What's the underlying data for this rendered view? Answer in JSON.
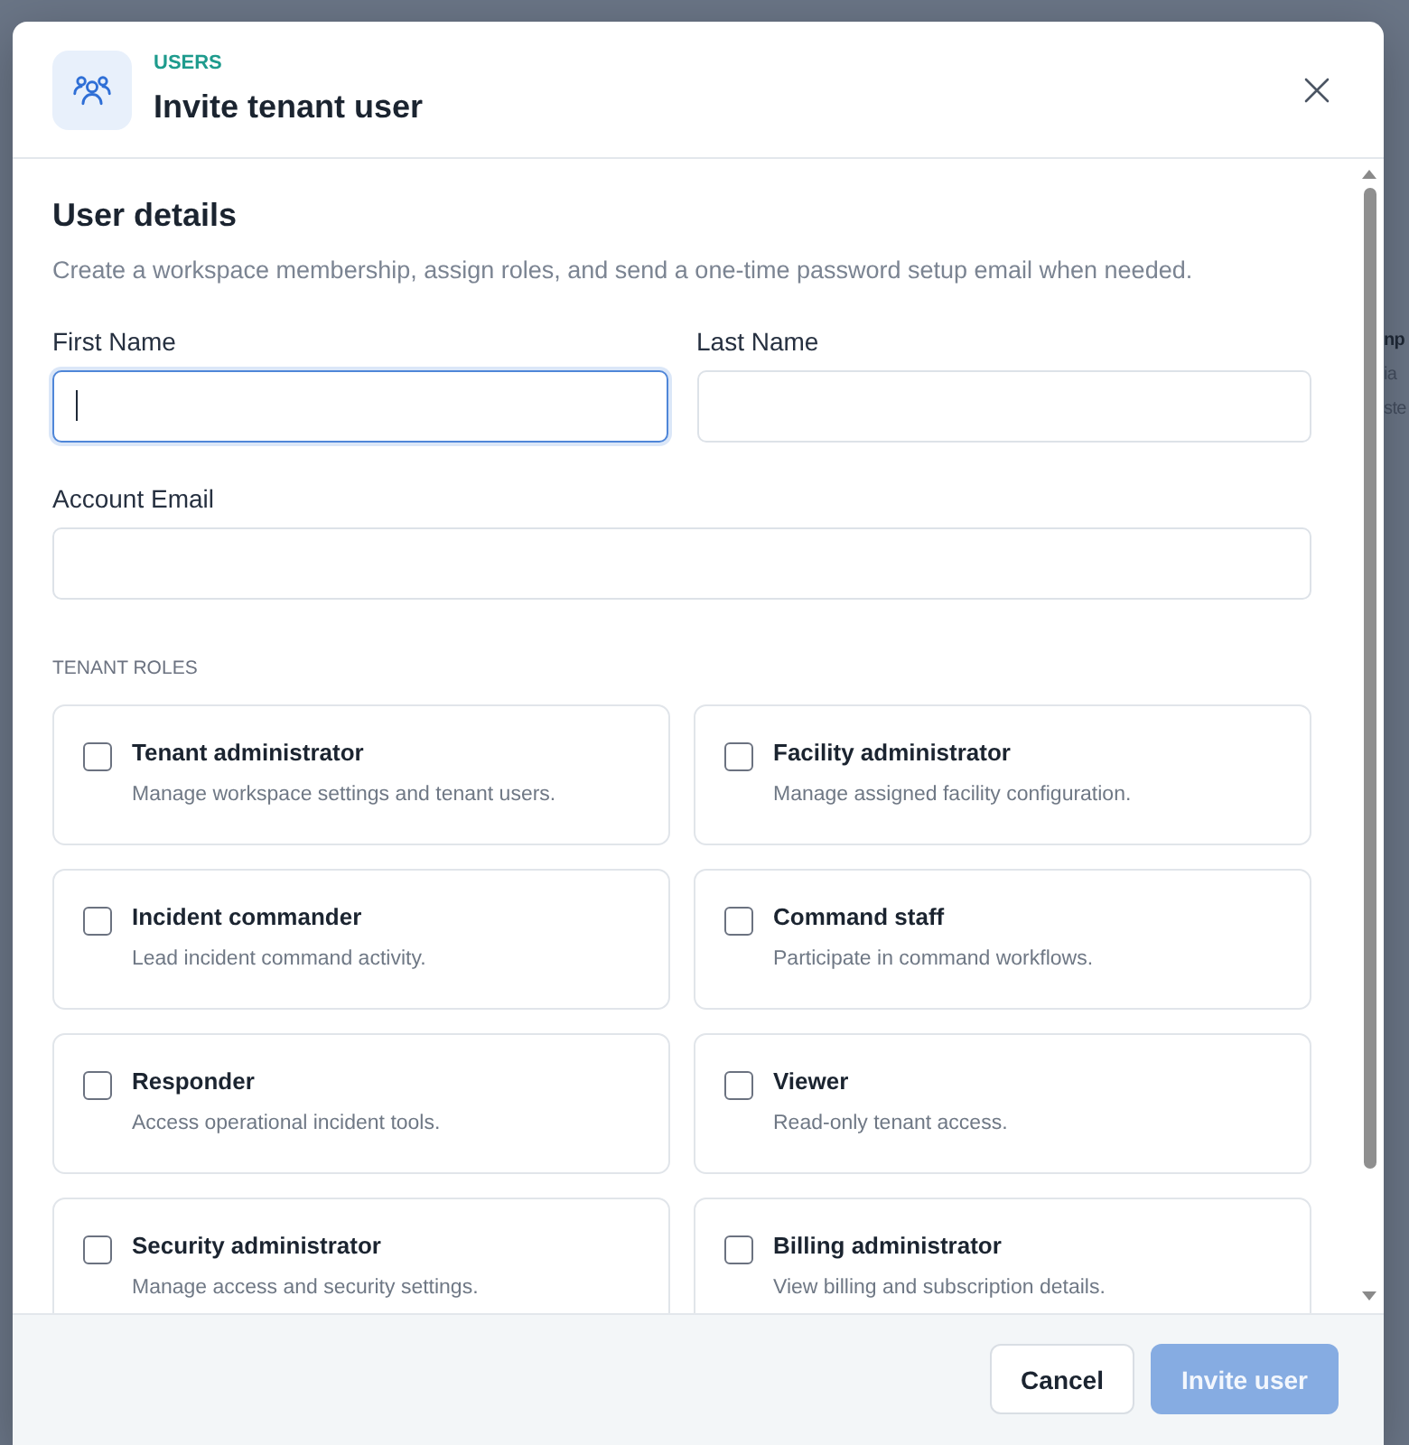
{
  "backdrop": {
    "fragments": [
      {
        "text": "np",
        "kind": "title"
      },
      {
        "text": "ia",
        "kind": "meta"
      },
      {
        "text": "ste",
        "kind": "meta"
      }
    ]
  },
  "dialog": {
    "eyebrow": "USERS",
    "title": "Invite tenant user"
  },
  "section": {
    "title": "User details",
    "description": "Create a workspace membership, assign roles, and send a one-time password setup email when needed."
  },
  "field_rows": [
    [
      {
        "label": "First Name",
        "focused": true
      },
      {
        "label": "Last Name",
        "focused": false
      }
    ],
    [
      {
        "label": "Account Email",
        "focused": false
      }
    ]
  ],
  "roles_heading": "TENANT ROLES",
  "roles": [
    {
      "title": "Tenant administrator",
      "description": "Manage workspace settings and tenant users.",
      "checked": false
    },
    {
      "title": "Facility administrator",
      "description": "Manage assigned facility configuration.",
      "checked": false
    },
    {
      "title": "Incident commander",
      "description": "Lead incident command activity.",
      "checked": false
    },
    {
      "title": "Command staff",
      "description": "Participate in command workflows.",
      "checked": false
    },
    {
      "title": "Responder",
      "description": "Access operational incident tools.",
      "checked": false
    },
    {
      "title": "Viewer",
      "description": "Read-only tenant access.",
      "checked": false
    },
    {
      "title": "Security administrator",
      "description": "Manage access and security settings.",
      "checked": false
    },
    {
      "title": "Billing administrator",
      "description": "View billing and subscription details.",
      "checked": false
    }
  ],
  "footer": {
    "buttons": [
      {
        "label": "Cancel",
        "kind": "secondary",
        "disabled": false
      },
      {
        "label": "Invite user",
        "kind": "primary",
        "disabled": true
      }
    ]
  }
}
